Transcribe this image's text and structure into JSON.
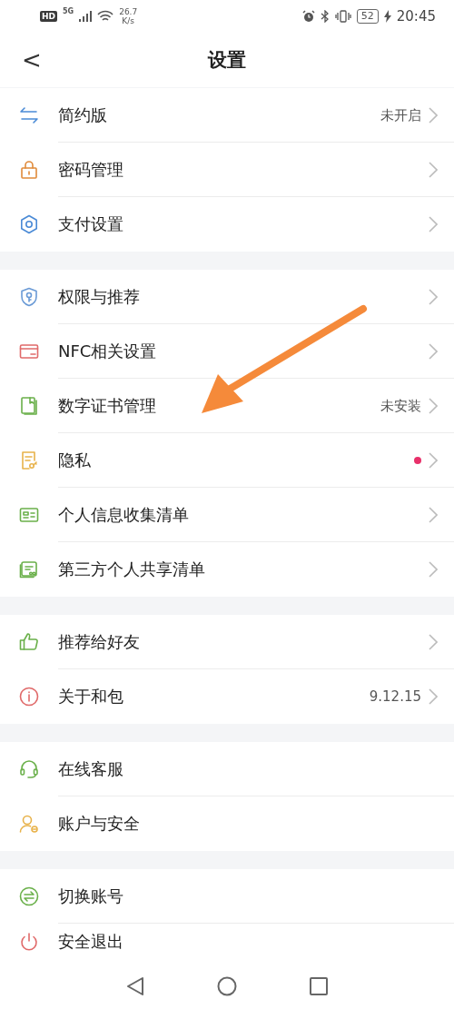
{
  "status_bar": {
    "hd": "HD",
    "network": "5G",
    "speed_value": "26.7",
    "speed_unit": "K/s",
    "battery": "52",
    "time": "20:45"
  },
  "header": {
    "back": "<",
    "title": "设置"
  },
  "groups": [
    {
      "rows": [
        {
          "label": "简约版",
          "value": "未开启",
          "dot": false,
          "chevron": true
        },
        {
          "label": "密码管理",
          "dot": false,
          "chevron": true
        },
        {
          "label": "支付设置",
          "dot": false,
          "chevron": true
        }
      ]
    },
    {
      "rows": [
        {
          "label": "权限与推荐",
          "dot": false,
          "chevron": true
        },
        {
          "label": "NFC相关设置",
          "dot": false,
          "chevron": true
        },
        {
          "label": "数字证书管理",
          "value": "未安装",
          "dot": false,
          "chevron": true
        },
        {
          "label": "隐私",
          "dot": true,
          "chevron": true
        },
        {
          "label": "个人信息收集清单",
          "dot": false,
          "chevron": true
        },
        {
          "label": "第三方个人共享清单",
          "dot": false,
          "chevron": true
        }
      ]
    },
    {
      "rows": [
        {
          "label": "推荐给好友",
          "dot": false,
          "chevron": true
        },
        {
          "label": "关于和包",
          "value": "9.12.15",
          "dot": false,
          "chevron": true
        }
      ]
    },
    {
      "rows": [
        {
          "label": "在线客服",
          "dot": false,
          "chevron": false
        },
        {
          "label": "账户与安全",
          "dot": false,
          "chevron": false
        }
      ]
    },
    {
      "rows": [
        {
          "label": "切换账号",
          "dot": false,
          "chevron": false
        },
        {
          "label": "安全退出",
          "dot": false,
          "chevron": false
        }
      ]
    }
  ]
}
